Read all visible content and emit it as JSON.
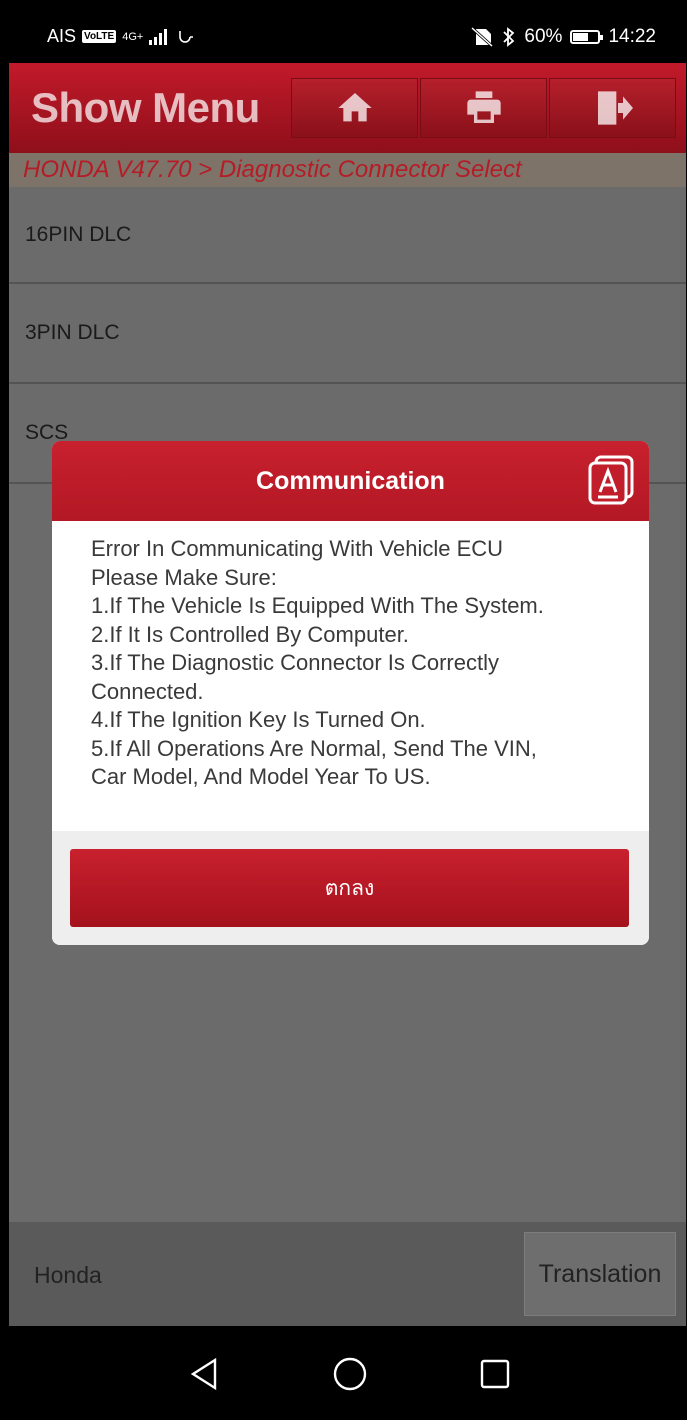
{
  "status_bar": {
    "carrier": "AIS",
    "volte": "VoLTE",
    "network": "4G+",
    "battery_percent": "60%",
    "battery_level": 0.6,
    "time": "14:22"
  },
  "header": {
    "title": "Show Menu",
    "buttons": [
      "home-icon",
      "print-icon",
      "exit-icon"
    ]
  },
  "breadcrumb": "HONDA V47.70 > Diagnostic Connector Select",
  "list": {
    "items": [
      "16PIN DLC",
      "3PIN  DLC",
      "SCS"
    ]
  },
  "modal": {
    "title": "Communication",
    "lines": [
      "Error In Communicating  With Vehicle ECU",
      "Please Make Sure:",
      "1.If The Vehicle Is Equipped With The System.",
      "2.If It Is Controlled By Computer.",
      "3.If The Diagnostic Connector Is Correctly",
      "Connected.",
      "4.If The Ignition Key Is Turned On.",
      "5.If All Operations Are Normal, Send The VIN,",
      "Car Model, And Model Year To US."
    ],
    "ok_label": "ตกลง"
  },
  "bottom": {
    "brand": "Honda",
    "translation_label": "Translation"
  },
  "colors": {
    "accent_red": "#c21a2a",
    "breadcrumb_red": "#b51c26",
    "overlay_gray": "#6b6b6b"
  }
}
